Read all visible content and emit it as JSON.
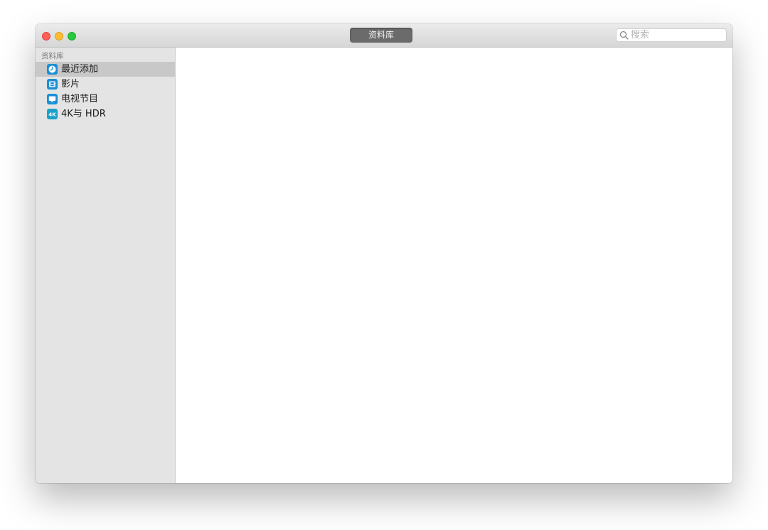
{
  "window": {
    "title_tab": "资料库"
  },
  "search": {
    "placeholder": "搜索"
  },
  "sidebar": {
    "section_header": "资料库",
    "items": [
      {
        "label": "最近添加",
        "icon": "clock-icon",
        "selected": true
      },
      {
        "label": "影片",
        "icon": "film-icon",
        "selected": false
      },
      {
        "label": "电视节目",
        "icon": "tv-icon",
        "selected": false
      },
      {
        "label": "4K与 HDR",
        "icon": "4k-icon",
        "icon_text": "4K",
        "selected": false
      }
    ]
  },
  "colors": {
    "accent": "#1a8fd6",
    "selected_row": "#c8c8c8",
    "sidebar_bg": "#e4e4e4",
    "close": "#fe5f57",
    "minimize": "#febc2e",
    "maximize": "#28c840"
  }
}
